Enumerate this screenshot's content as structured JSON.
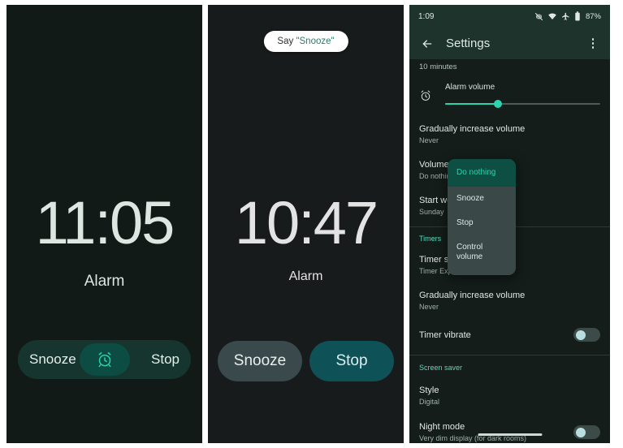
{
  "panels": {
    "alarm_firing": {
      "time": "11:05",
      "label": "Alarm",
      "snooze_label": "Snooze",
      "stop_label": "Stop",
      "knob_icon": "alarm-clock-icon",
      "accent": "#0c4c43",
      "track_bg": "#16352e",
      "background": "#121a17",
      "text_color": "#dde7e1"
    },
    "alarm_voice": {
      "chip_prefix": "Say",
      "chip_quoted": "\"Snooze\"",
      "time": "10:47",
      "label": "Alarm",
      "snooze_label": "Snooze",
      "stop_label": "Stop",
      "snooze_bg": "#3a4a4c",
      "stop_bg": "#0e5157",
      "background": "#181b1b",
      "text_color": "#e3e3e3"
    },
    "settings": {
      "status_bar": {
        "time": "1:09",
        "battery_percent": "87%",
        "icons": [
          "vibrate-off-icon",
          "wifi-icon",
          "airplane-mode-icon",
          "battery-icon"
        ]
      },
      "app_bar": {
        "back_icon": "back-arrow-icon",
        "title": "Settings",
        "overflow_icon": "more-options-icon"
      },
      "partial_top_value": "10 minutes",
      "alarm_volume": {
        "icon": "alarm-clock-icon",
        "label": "Alarm volume",
        "value_percent": 34,
        "fill_color": "#2ad4ad",
        "track_color": "#4d5a56"
      },
      "rows": [
        {
          "title": "Gradually increase volume",
          "sub": "Never"
        },
        {
          "title": "Volume buttons",
          "sub": "Do nothing"
        },
        {
          "title": "Start week on",
          "sub": "Sunday"
        }
      ],
      "timers_section": {
        "header": "Timers",
        "header_color": "#5fd8bd",
        "rows": [
          {
            "title": "Timer sound",
            "sub": "Timer Expired"
          },
          {
            "title": "Gradually increase volume",
            "sub": "Never"
          }
        ],
        "toggle": {
          "title": "Timer vibrate",
          "state": "off"
        }
      },
      "screensaver_section": {
        "header": "Screen saver",
        "header_color": "#5fd8bd",
        "rows": [
          {
            "title": "Style",
            "sub": "Digital"
          }
        ],
        "toggle": {
          "title": "Night mode",
          "sub": "Very dim display (for dark rooms)",
          "state": "off"
        }
      },
      "dropdown": {
        "selected": "Do nothing",
        "selected_bg": "#0d4f43",
        "selected_text": "#2ad4ad",
        "items": [
          "Do nothing",
          "Snooze",
          "Stop",
          "Control volume"
        ]
      }
    }
  }
}
